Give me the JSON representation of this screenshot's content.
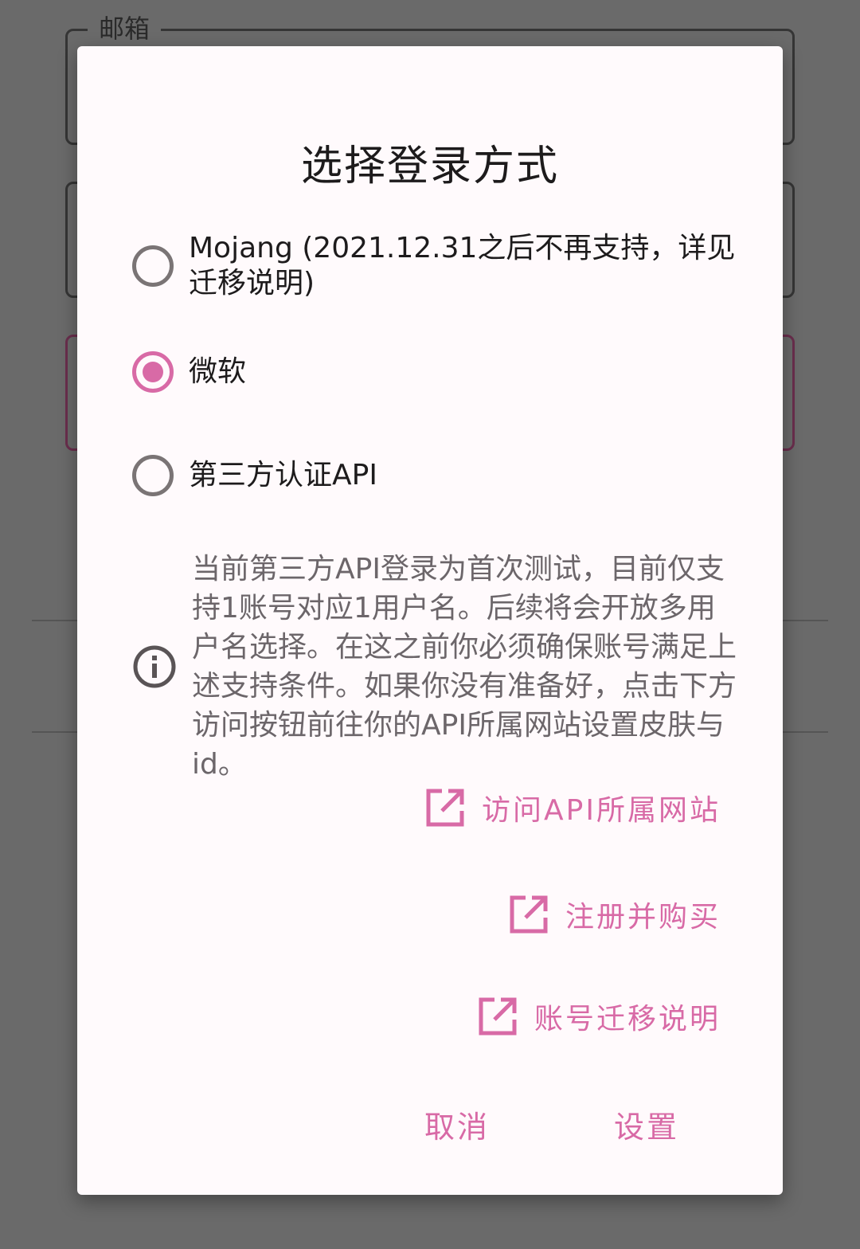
{
  "background": {
    "email_legend": "邮箱"
  },
  "dialog": {
    "title": "选择登录方式",
    "options": [
      {
        "label": "Mojang (2021.12.31之后不再支持，详见迁移说明)",
        "selected": false
      },
      {
        "label": "微软",
        "selected": true
      },
      {
        "label": "第三方认证API",
        "selected": false
      }
    ],
    "info_text": "当前第三方API登录为首次测试，目前仅支持1账号对应1用户名。后续将会开放多用户名选择。在这之前你必须确保账号满足上述支持条件。如果你没有准备好，点击下方访问按钮前往你的API所属网站设置皮肤与id。",
    "links": [
      {
        "label": "访问API所属网站",
        "icon": "open-in-new-icon"
      },
      {
        "label": "注册并购买",
        "icon": "open-in-new-icon"
      },
      {
        "label": "账号迁移说明",
        "icon": "open-in-new-icon"
      }
    ],
    "cancel_label": "取消",
    "confirm_label": "设置"
  },
  "colors": {
    "accent": "#d86aa6",
    "radio_unselected": "#7a7475",
    "scrim": "#6a6a6a",
    "dialog_bg": "#fffafc"
  }
}
